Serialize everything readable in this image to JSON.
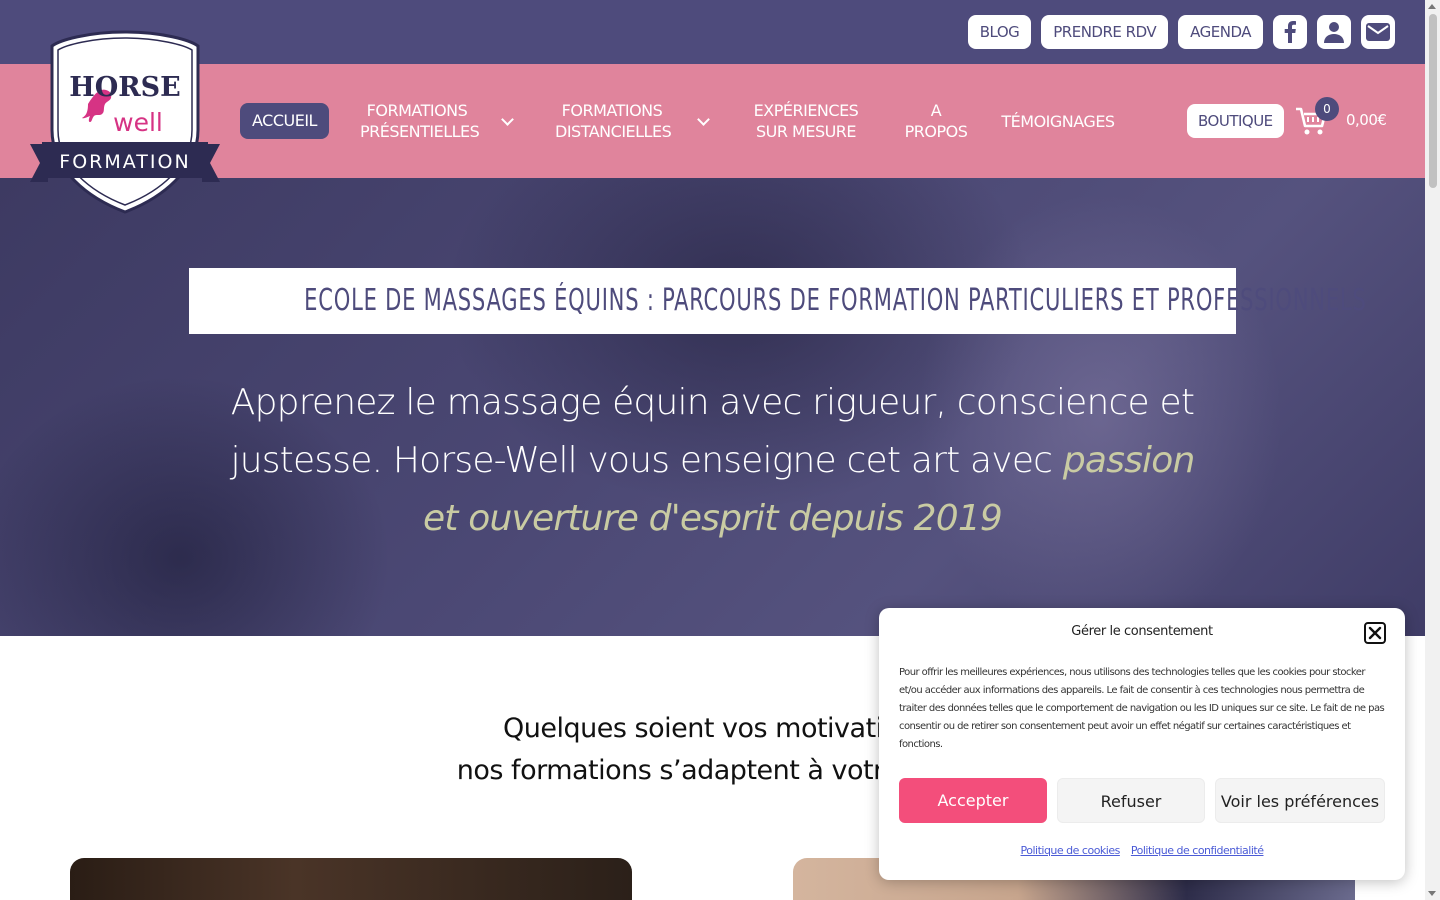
{
  "topbar": {
    "links": [
      "BLOG",
      "PRENDRE RDV",
      "AGENDA"
    ],
    "icons": [
      "facebook-icon",
      "user-icon",
      "mail-icon"
    ]
  },
  "logo": {
    "line1": "HORSE",
    "line2": "well",
    "line3": "FORMATION"
  },
  "nav": {
    "accueil": "ACCUEIL",
    "formations_presentielles_1": "FORMATIONS",
    "formations_presentielles_2": "PRÉSENTIELLES",
    "formations_distancielles_1": "FORMATIONS",
    "formations_distancielles_2": "DISTANCIELLES",
    "experiences_1": "EXPÉRIENCES",
    "experiences_2": "SUR MESURE",
    "apropos_1": "A",
    "apropos_2": "PROPOS",
    "temoignages": "TÉMOIGNAGES",
    "boutique": "BOUTIQUE",
    "cart_count": "0",
    "cart_total": "0,00€"
  },
  "hero": {
    "title": "Ecole de massages équins : parcours de formation particuliers et professionnels",
    "text_main": "Apprenez le massage équin avec rigueur, conscience et justesse. Horse-Well vous enseigne cet art avec ",
    "text_accent": "passion et ouverture d'esprit depuis 2019"
  },
  "section": {
    "title_line1": "Quelques soient vos motivations,",
    "title_line2": "nos formations s’adaptent à votre projet"
  },
  "cookie": {
    "title": "Gérer le consentement",
    "body": "Pour offrir les meilleures expériences, nous utilisons des technologies telles que les cookies pour stocker et/ou accéder aux informations des appareils. Le fait de consentir à ces technologies nous permettra de traiter des données telles que le comportement de navigation ou les ID uniques sur ce site. Le fait de ne pas consentir ou de retirer son consentement peut avoir un effet négatif sur certaines caractéristiques et fonctions.",
    "accept": "Accepter",
    "refuse": "Refuser",
    "preferences": "Voir les préférences",
    "link_cookies": "Politique de cookies",
    "link_privacy": "Politique de confidentialité"
  },
  "colors": {
    "primary": "#4e4b7c",
    "pink": "#e0849c",
    "accept": "#f34e7b",
    "accent_text": "#c9cba3"
  }
}
